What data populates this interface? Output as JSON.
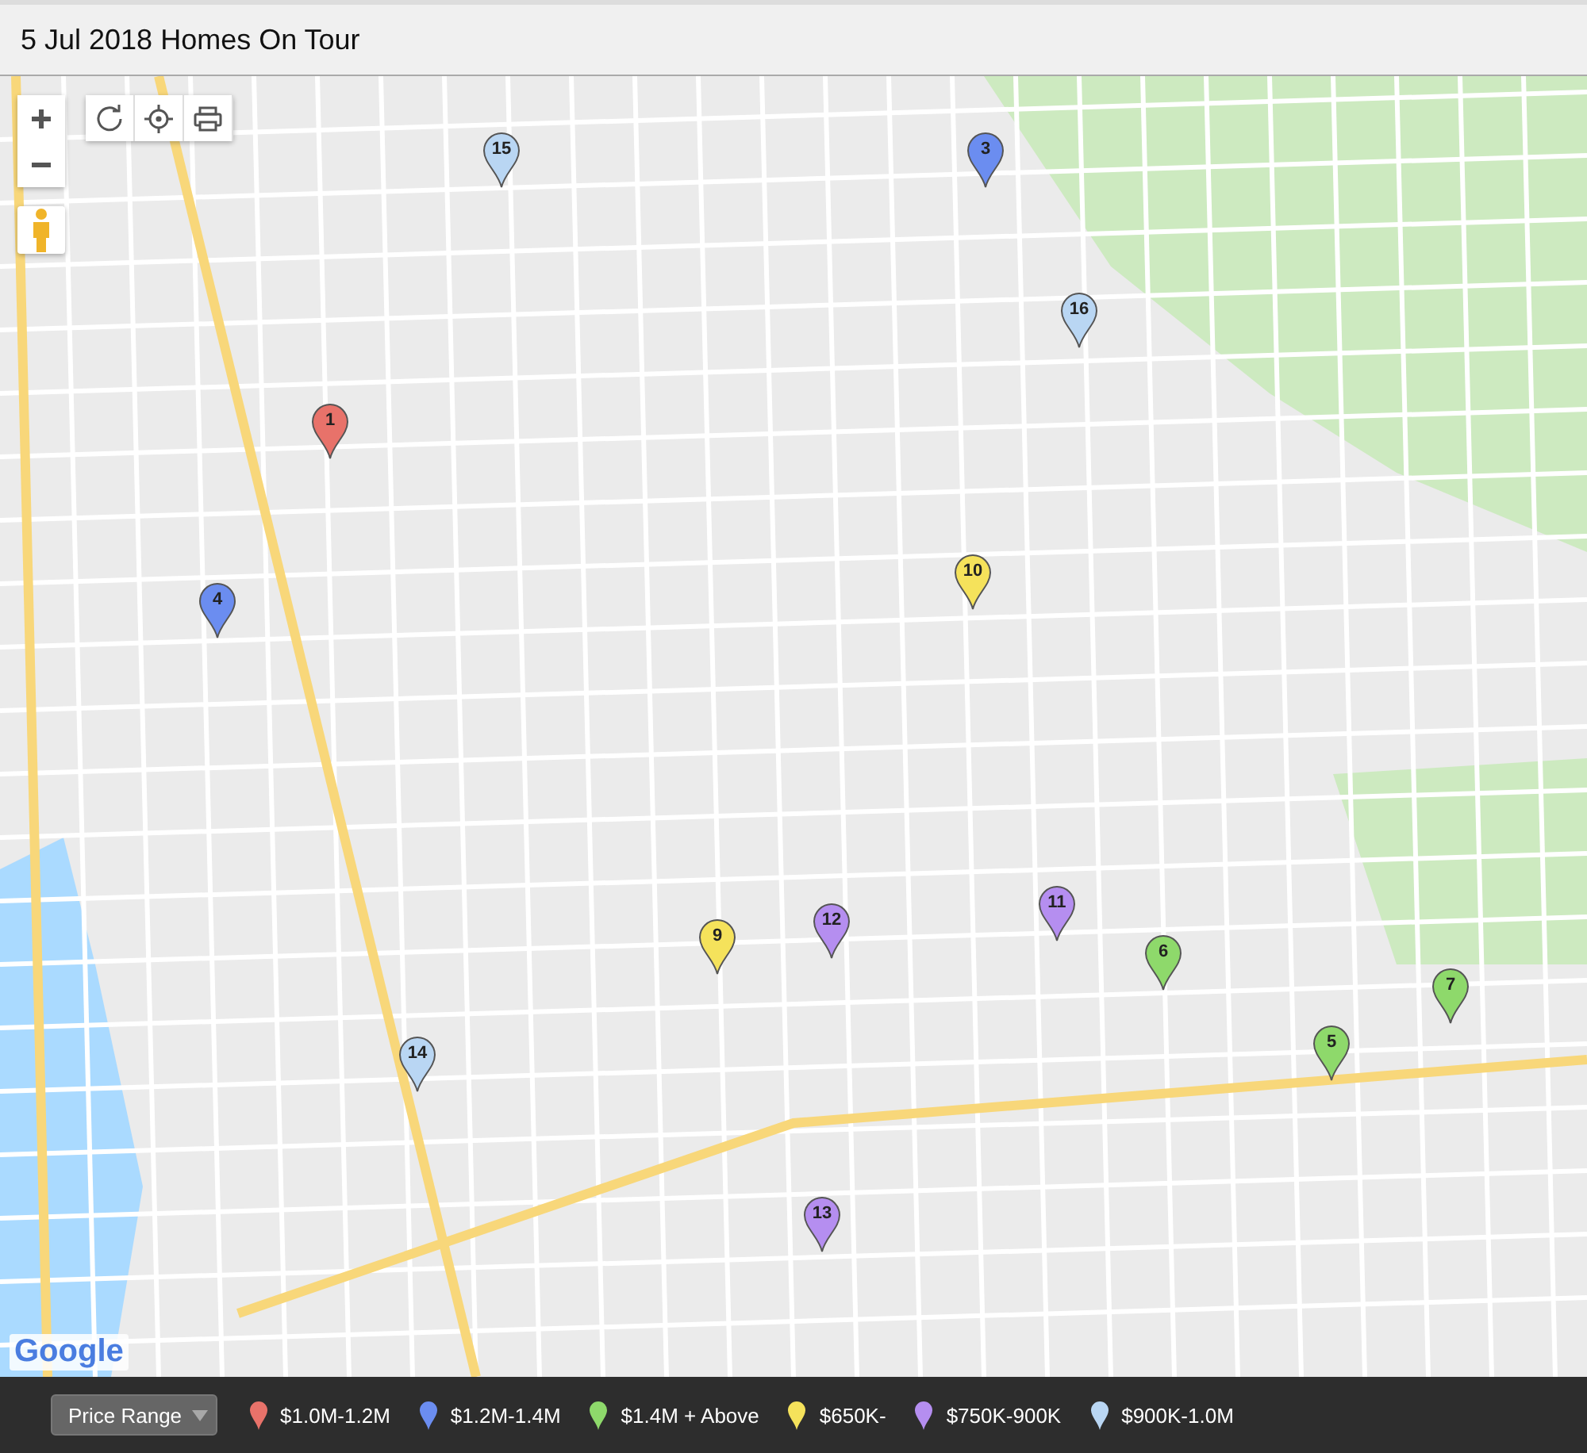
{
  "title": "5 Jul 2018 Homes On Tour",
  "map_logo": "Google",
  "pins": [
    {
      "label": "1",
      "color": "#e8726a"
    },
    {
      "label": "3",
      "color": "#6b8df0"
    },
    {
      "label": "4",
      "color": "#6b8df0"
    },
    {
      "label": "5",
      "color": "#8ed96b"
    },
    {
      "label": "6",
      "color": "#8ed96b"
    },
    {
      "label": "7",
      "color": "#8ed96b"
    },
    {
      "label": "9",
      "color": "#f5e25b"
    },
    {
      "label": "10",
      "color": "#f5e25b"
    },
    {
      "label": "11",
      "color": "#b58ef0"
    },
    {
      "label": "12",
      "color": "#b58ef0"
    },
    {
      "label": "13",
      "color": "#b58ef0"
    },
    {
      "label": "14",
      "color": "#b9d6f3"
    },
    {
      "label": "15",
      "color": "#b9d6f3"
    },
    {
      "label": "16",
      "color": "#b9d6f3"
    }
  ],
  "legend": {
    "dropdown": "Price Range",
    "items": [
      {
        "label": "$1.0M-1.2M",
        "color": "#e8726a"
      },
      {
        "label": "$1.2M-1.4M",
        "color": "#6b8df0"
      },
      {
        "label": "$1.4M + Above",
        "color": "#8ed96b"
      },
      {
        "label": "$650K-",
        "color": "#f5e25b"
      },
      {
        "label": "$750K-900K",
        "color": "#b58ef0"
      },
      {
        "label": "$900K-1.0M",
        "color": "#b9d6f3"
      }
    ]
  }
}
